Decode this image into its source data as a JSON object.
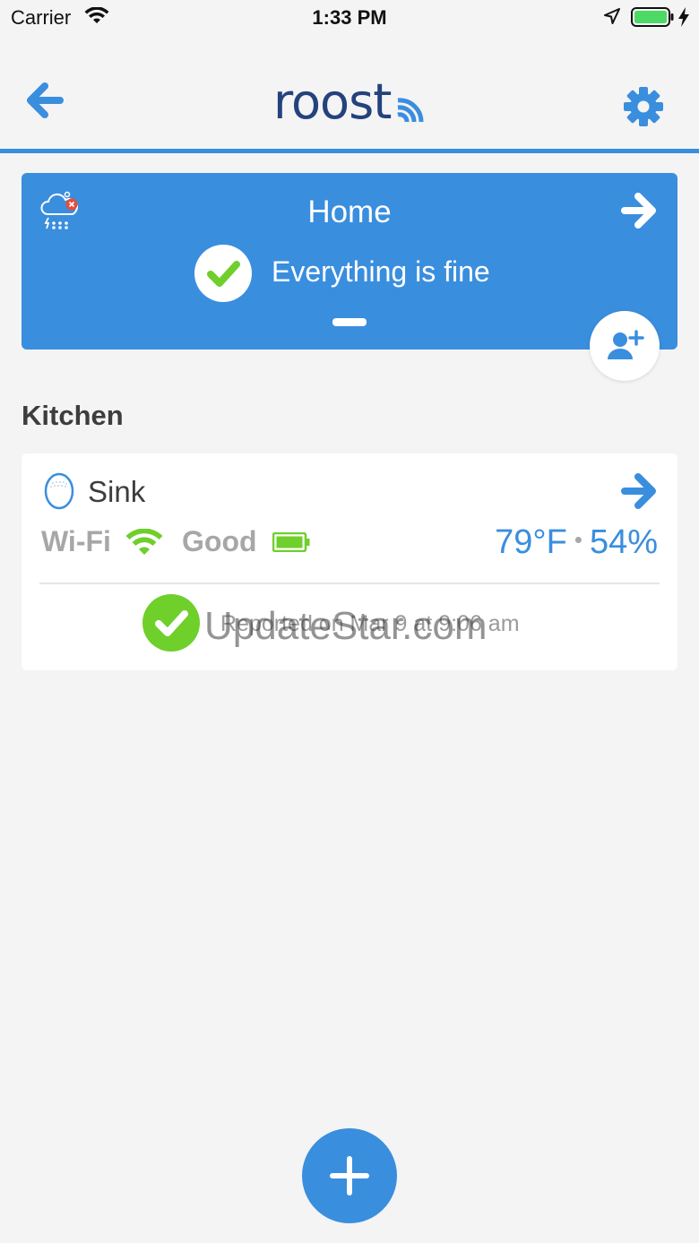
{
  "status_bar": {
    "carrier": "Carrier",
    "time": "1:33 PM",
    "battery_color": "#4cd964"
  },
  "nav": {
    "logo_text": "roost",
    "back_icon": "arrow-left-icon",
    "settings_icon": "gear-icon"
  },
  "home_card": {
    "title": "Home",
    "status": "Everything is fine",
    "weather_icon": "storm-cloud-alert-icon",
    "add_user_icon": "add-user-icon"
  },
  "room": {
    "name": "Kitchen",
    "device": {
      "name": "Sink",
      "connection_label": "Wi-Fi",
      "signal_label": "Good",
      "temperature": "79°F",
      "humidity": "54%",
      "report_text": "Reported on Mar 9 at 9:06 am",
      "watermark": "UpdateStar.com"
    }
  },
  "colors": {
    "accent": "#3a8ede",
    "logo": "#24427d",
    "ok_green": "#6fcf2b",
    "muted": "#a7a7a9",
    "background": "#f4f4f5"
  }
}
